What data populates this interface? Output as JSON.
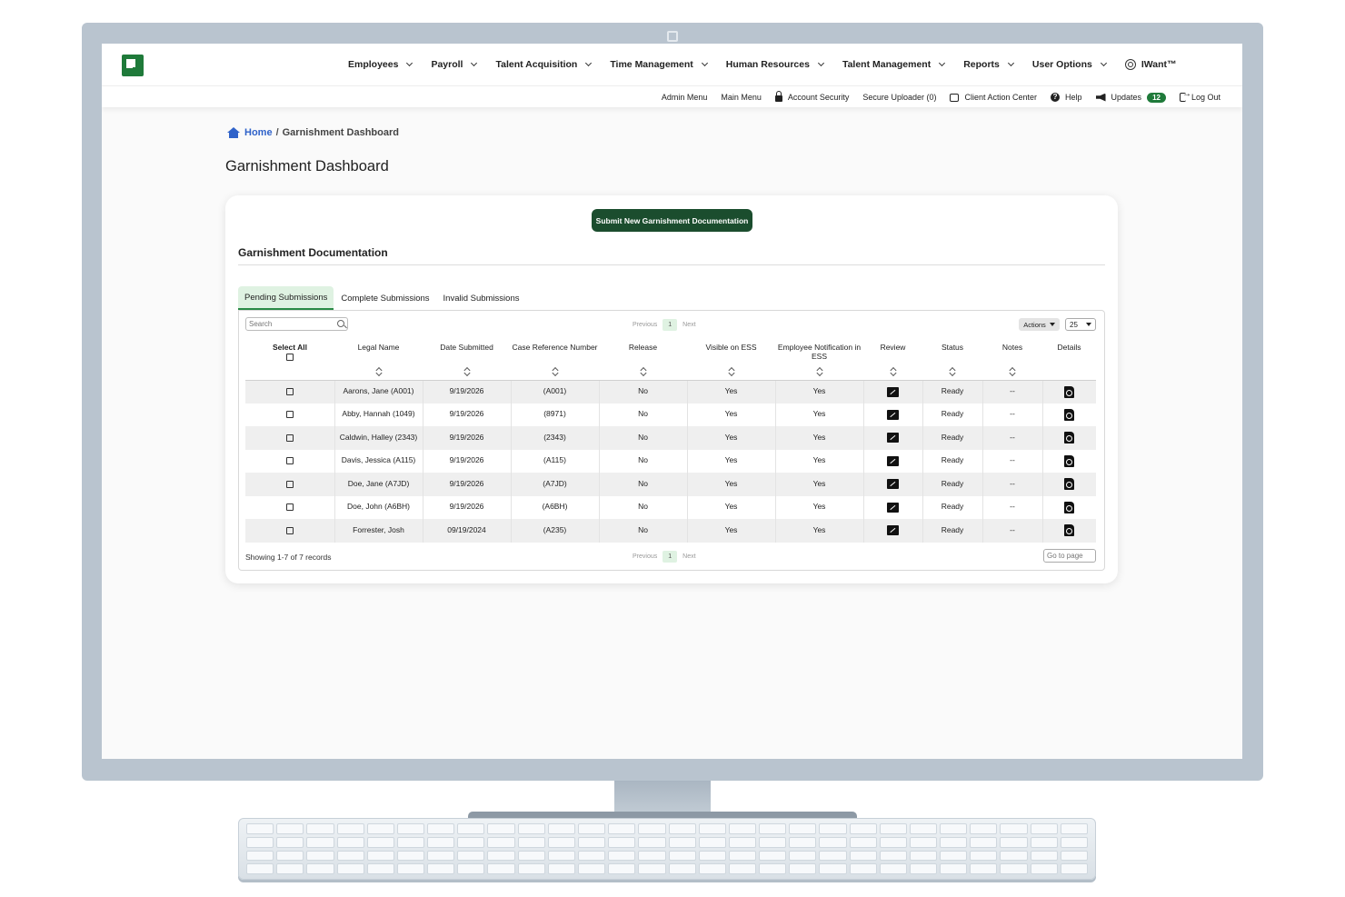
{
  "header": {
    "nav": [
      {
        "label": "Employees"
      },
      {
        "label": "Payroll"
      },
      {
        "label": "Talent Acquisition"
      },
      {
        "label": "Time Management"
      },
      {
        "label": "Human Resources"
      },
      {
        "label": "Talent Management"
      },
      {
        "label": "Reports"
      },
      {
        "label": "User Options"
      }
    ],
    "iwant_label": "IWant™",
    "sub": {
      "admin_menu": "Admin Menu",
      "main_menu": "Main Menu",
      "account_security": "Account Security",
      "secure_uploader": "Secure Uploader (0)",
      "client_action_center": "Client Action Center",
      "help": "Help",
      "updates": "Updates",
      "updates_count": "12",
      "log_out": "Log Out"
    }
  },
  "breadcrumb": {
    "home": "Home",
    "separator": "/",
    "current": "Garnishment Dashboard"
  },
  "page_title": "Garnishment Dashboard",
  "card": {
    "submit_label": "Submit New Garnishment Documentation",
    "section_title": "Garnishment Documentation",
    "tabs": [
      {
        "label": "Pending Submissions"
      },
      {
        "label": "Complete Submissions"
      },
      {
        "label": "Invalid Submissions"
      }
    ],
    "search_placeholder": "Search",
    "pager": {
      "previous": "Previous",
      "page": "1",
      "next": "Next"
    },
    "actions_label": "Actions",
    "page_size": "25",
    "columns": {
      "select_all": "Select All",
      "legal_name": "Legal Name",
      "date_submitted": "Date Submitted",
      "case_ref": "Case Reference Number",
      "release": "Release",
      "visible_ess": "Visible on ESS",
      "emp_notif": "Employee Notification in ESS",
      "review": "Review",
      "status": "Status",
      "notes": "Notes",
      "details": "Details"
    },
    "rows": [
      {
        "name": "Aarons, Jane (A001)",
        "date": "9/19/2026",
        "case": "(A001)",
        "release": "No",
        "visible": "Yes",
        "notif": "Yes",
        "status": "Ready",
        "notes": "--"
      },
      {
        "name": "Abby, Hannah (1049)",
        "date": "9/19/2026",
        "case": "(8971)",
        "release": "No",
        "visible": "Yes",
        "notif": "Yes",
        "status": "Ready",
        "notes": "--"
      },
      {
        "name": "Caldwin, Halley (2343)",
        "date": "9/19/2026",
        "case": "(2343)",
        "release": "No",
        "visible": "Yes",
        "notif": "Yes",
        "status": "Ready",
        "notes": "--"
      },
      {
        "name": "Davis, Jessica (A115)",
        "date": "9/19/2026",
        "case": "(A115)",
        "release": "No",
        "visible": "Yes",
        "notif": "Yes",
        "status": "Ready",
        "notes": "--"
      },
      {
        "name": "Doe, Jane (A7JD)",
        "date": "9/19/2026",
        "case": "(A7JD)",
        "release": "No",
        "visible": "Yes",
        "notif": "Yes",
        "status": "Ready",
        "notes": "--"
      },
      {
        "name": "Doe, John (A6BH)",
        "date": "9/19/2026",
        "case": "(A6BH)",
        "release": "No",
        "visible": "Yes",
        "notif": "Yes",
        "status": "Ready",
        "notes": "--"
      },
      {
        "name": "Forrester, Josh",
        "date": "09/19/2024",
        "case": "(A235)",
        "release": "No",
        "visible": "Yes",
        "notif": "Yes",
        "status": "Ready",
        "notes": "--"
      }
    ],
    "records_label": "Showing 1-7 of 7 records",
    "goto_placeholder": "Go to page"
  },
  "colors": {
    "brand_green": "#1f7a3a",
    "button_green": "#1b4d2e",
    "tab_active_bg": "#dff2e2",
    "link_blue": "#2f62c9"
  }
}
